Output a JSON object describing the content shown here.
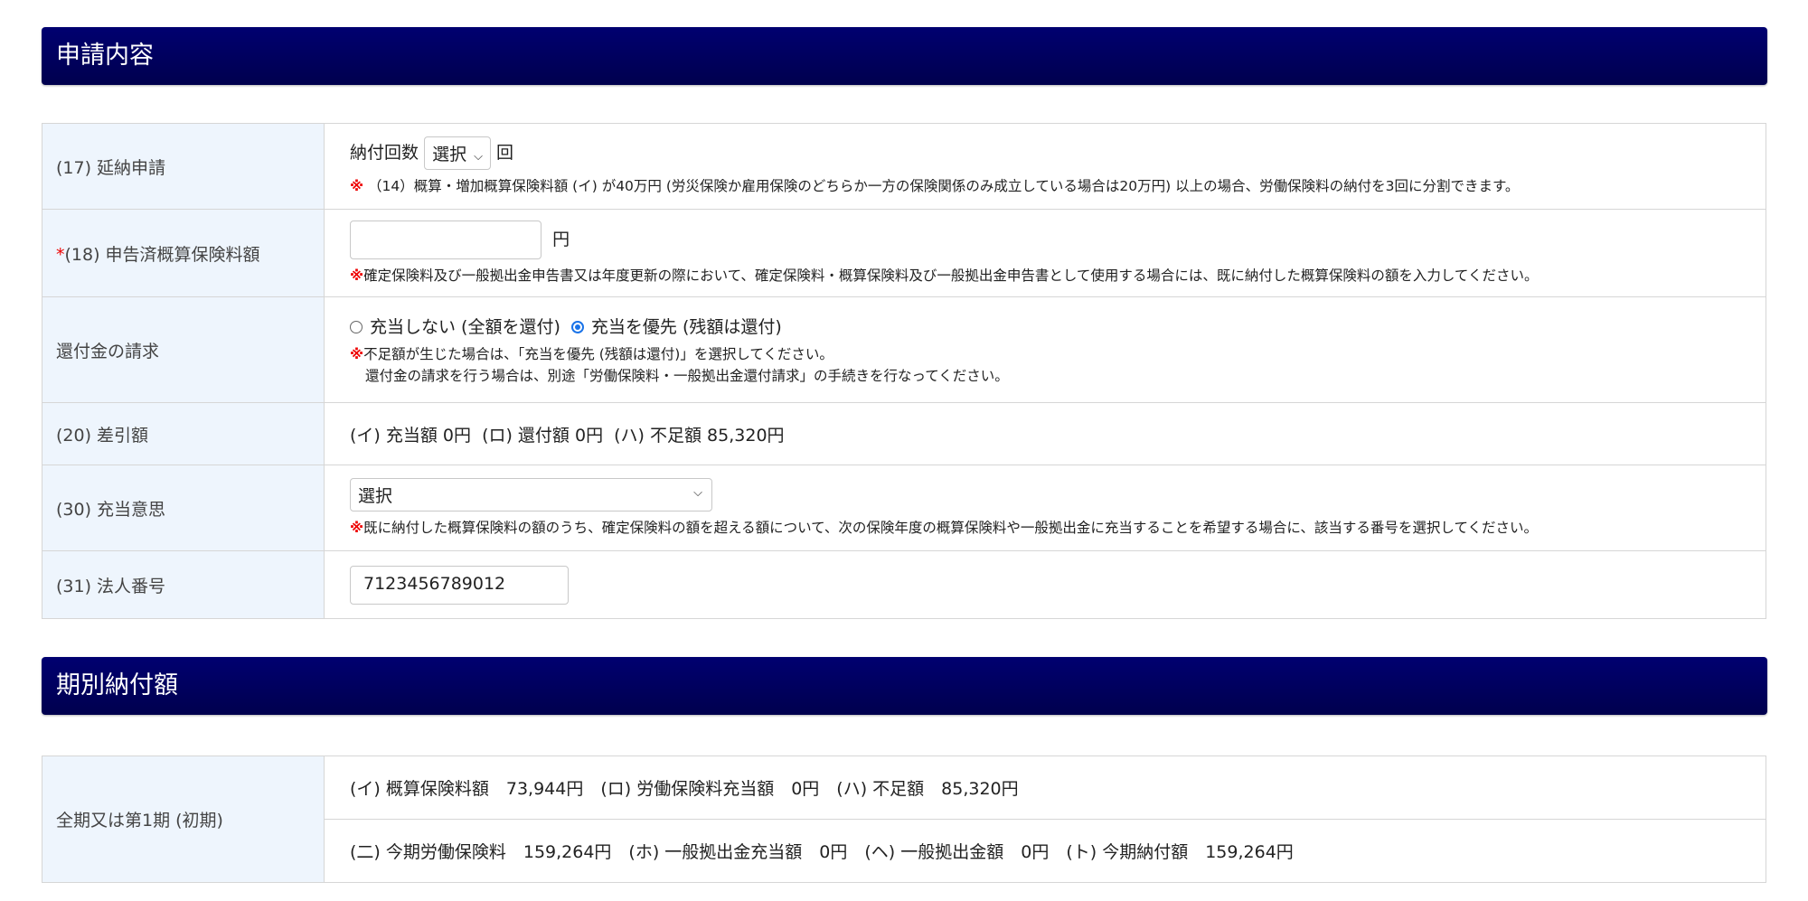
{
  "section1": {
    "title": "申請内容",
    "rows": {
      "r17": {
        "label": "(17) 延納申請",
        "prefix": "納付回数",
        "select": "選択",
        "suffix": "回",
        "note": "（14）概算・増加概算保険料額 (イ) が40万円 (労災保険か雇用保険のどちらか一方の保険関係のみ成立している場合は20万円) 以上の場合、労働保険料の納付を3回に分割できます。"
      },
      "r18": {
        "required": "*",
        "label": "(18) 申告済概算保険料額",
        "value": "",
        "unit": "円",
        "note": "確定保険料及び一般拠出金申告書又は年度更新の際において、確定保険料・概算保険料及び一般拠出金申告書として使用する場合には、既に納付した概算保険料の額を入力してください。"
      },
      "r19": {
        "label": "還付金の請求",
        "option1": "充当しない (全額を還付)",
        "option2": "充当を優先 (残額は還付)",
        "selected": "option2",
        "note1": "不足額が生じた場合は、「充当を優先 (残額は還付)」を選択してください。",
        "note2": "還付金の請求を行う場合は、別途「労働保険料・一般拠出金還付請求」の手続きを行なってください。"
      },
      "r20": {
        "label": "(20) 差引額",
        "text": "(イ) 充当額 0円  (ロ) 還付額 0円  (ハ) 不足額 85,320円"
      },
      "r30": {
        "label": "(30) 充当意思",
        "select": "選択",
        "note": "既に納付した概算保険料の額のうち、確定保険料の額を超える額について、次の保険年度の概算保険料や一般拠出金に充当することを希望する場合に、該当する番号を選択してください。"
      },
      "r31": {
        "label": "(31) 法人番号",
        "value": "7123456789012"
      }
    },
    "kome": "※"
  },
  "section2": {
    "title": "期別納付額",
    "label": "全期又は第1期 (初期)",
    "line1": "(イ) 概算保険料額　73,944円　(ロ) 労働保険料充当額　0円　(ハ) 不足額　85,320円",
    "line2": "(二) 今期労働保険料　159,264円　(ホ) 一般拠出金充当額　0円　(ヘ) 一般拠出金額　0円　(ト) 今期納付額　159,264円"
  }
}
